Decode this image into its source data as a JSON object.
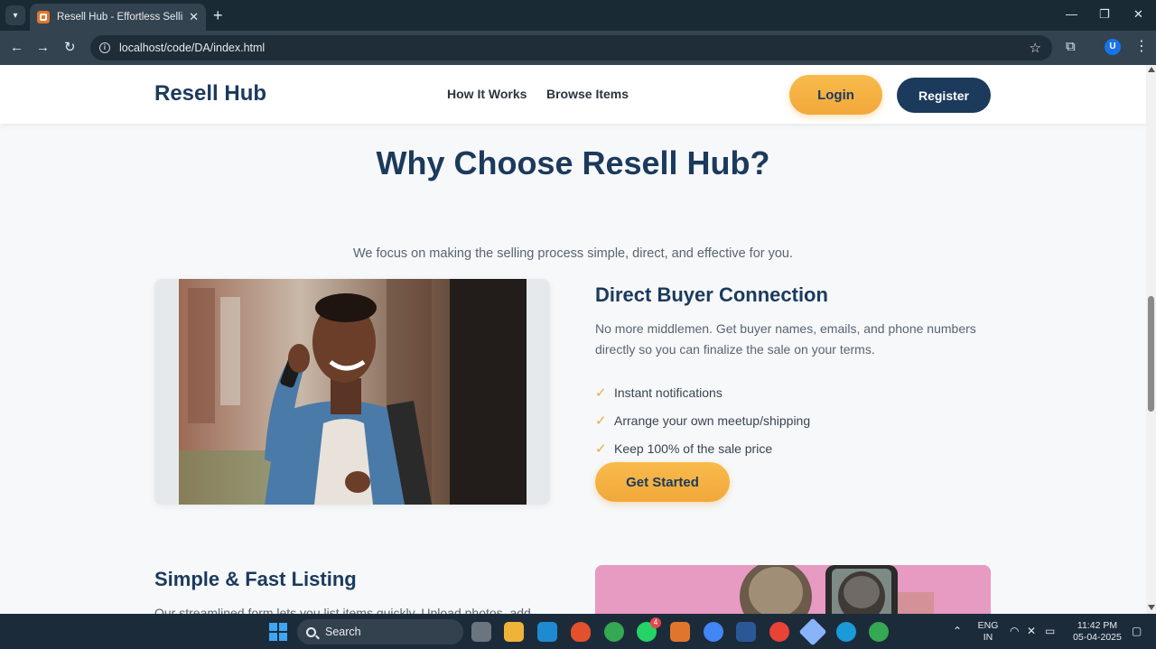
{
  "browser": {
    "tab_title": "Resell Hub - Effortless Selling, D",
    "url": "localhost/code/DA/index.html",
    "profile_initial": "U"
  },
  "header": {
    "logo": "Resell Hub",
    "nav": [
      "How It Works",
      "Browse Items"
    ],
    "login_label": "Login",
    "register_label": "Register"
  },
  "section": {
    "title": "Why Choose Resell Hub?",
    "subtitle": "We focus on making the selling process simple, direct, and effective for you."
  },
  "feature1": {
    "title": "Direct Buyer Connection",
    "description": "No more middlemen. Get buyer names, emails, and phone numbers directly so you can finalize the sale on your terms.",
    "bullets": [
      "Instant notifications",
      "Arrange your own meetup/shipping",
      "Keep 100% of the sale price"
    ],
    "cta": "Get Started"
  },
  "feature2": {
    "title": "Simple & Fast Listing",
    "description": "Our streamlined form lets you list items quickly. Upload photos, add"
  },
  "taskbar": {
    "search_label": "Search",
    "badges": {
      "whatsapp": "4"
    },
    "lang_top": "ENG",
    "lang_bottom": "IN",
    "time": "11:42 PM",
    "date": "05-04-2025"
  },
  "colors": {
    "brand_navy": "#1b3a5c",
    "accent_orange": "#f2a83a",
    "browser_dark": "#1a2a35",
    "taskbar": "#1c2b3a"
  }
}
